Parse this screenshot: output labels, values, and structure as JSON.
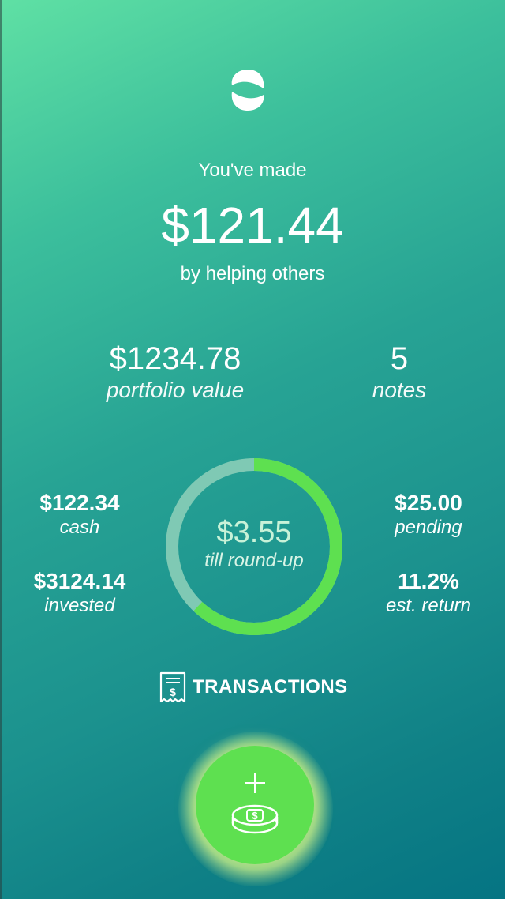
{
  "header": {
    "logo_icon": "s-swirl-logo-icon",
    "made_label": "You've made",
    "made_amount": "$121.44",
    "made_sub": "by helping others"
  },
  "summary": {
    "portfolio_value": "$1234.78",
    "portfolio_label": "portfolio value",
    "notes_value": "5",
    "notes_label": "notes"
  },
  "stats": {
    "cash_value": "$122.34",
    "cash_label": "cash",
    "invested_value": "$3124.14",
    "invested_label": "invested",
    "pending_value": "$25.00",
    "pending_label": "pending",
    "return_value": "11.2%",
    "return_label": "est. return"
  },
  "roundup": {
    "amount": "$3.55",
    "label": "till round-up",
    "progress_fraction": 0.62,
    "progress_color": "#5ee050",
    "track_color": "#7fc9b4"
  },
  "transactions": {
    "icon": "receipt-icon",
    "label": "TRANSACTIONS"
  },
  "fab": {
    "icon": "add-coins-icon",
    "color": "#5ee050"
  }
}
